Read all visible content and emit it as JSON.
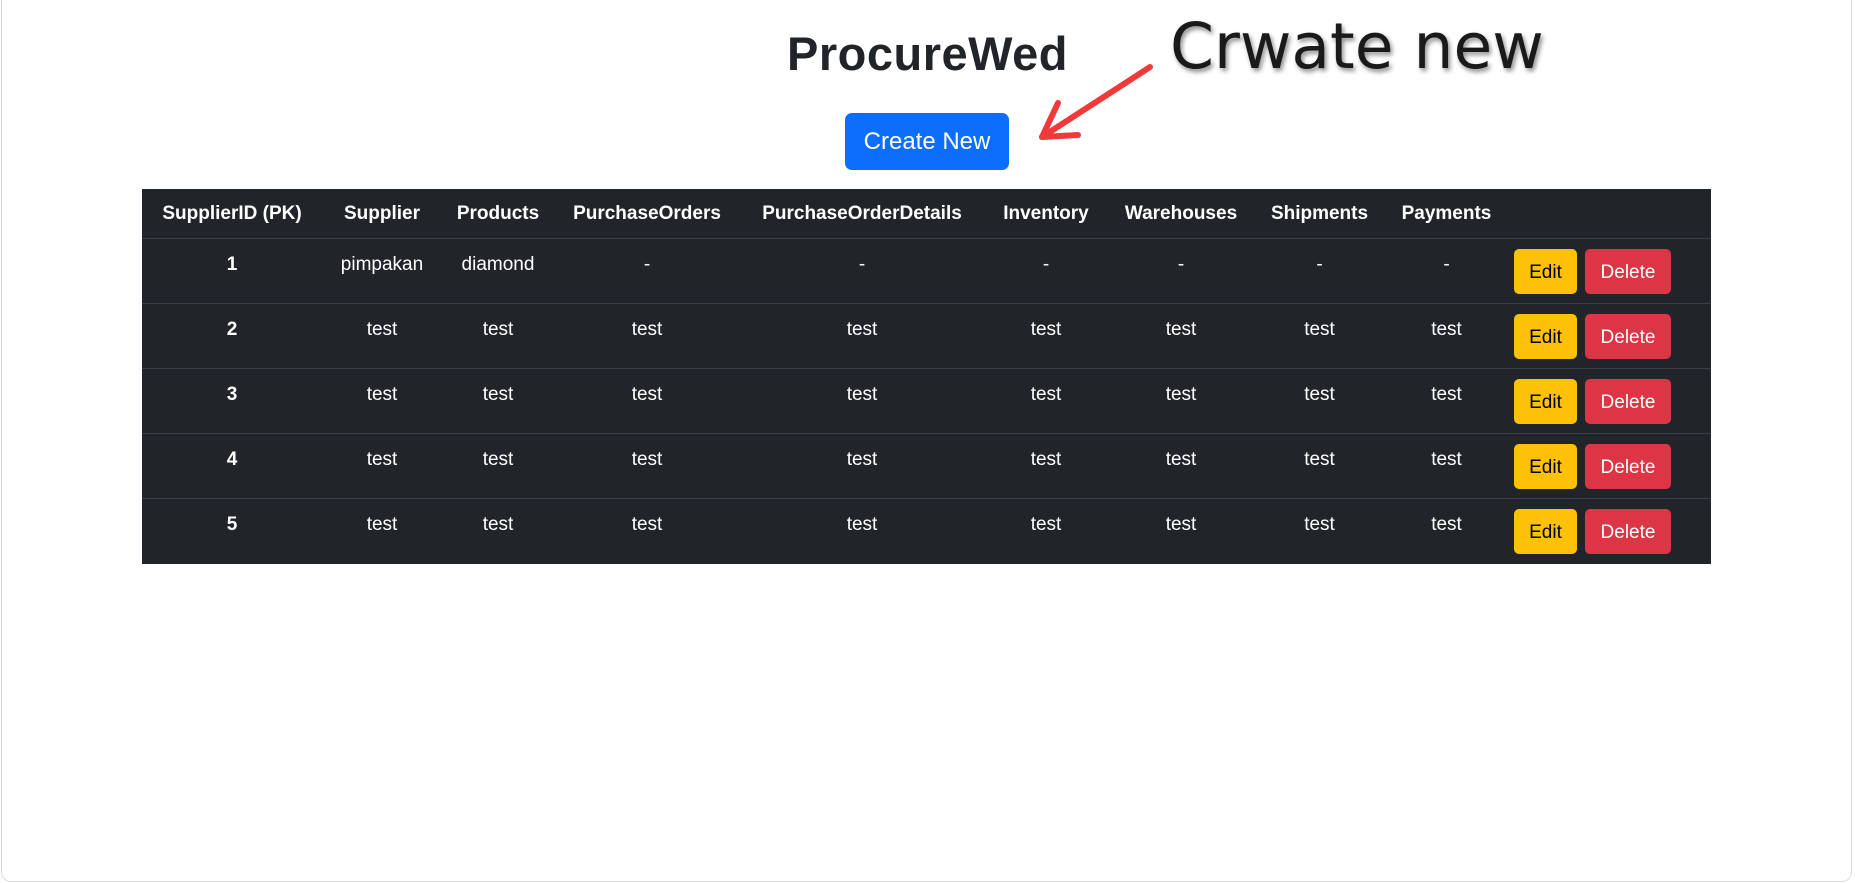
{
  "page": {
    "title": "ProcureWed",
    "create_button_label": "Create New"
  },
  "annotation": {
    "text": "Crwate new",
    "arrow_color": "#f0393a"
  },
  "colors": {
    "primary": "#0d6efd",
    "warning": "#ffc107",
    "danger": "#dc3545",
    "table_bg": "#212529"
  },
  "table": {
    "columns": [
      "SupplierID (PK)",
      "Supplier",
      "Products",
      "PurchaseOrders",
      "PurchaseOrderDetails",
      "Inventory",
      "Warehouses",
      "Shipments",
      "Payments",
      ""
    ],
    "rows": [
      {
        "id": "1",
        "supplier": "pimpakan",
        "products": "diamond",
        "purchase_orders": "-",
        "purchase_order_details": "-",
        "inventory": "-",
        "warehouses": "-",
        "shipments": "-",
        "payments": "-",
        "edit_label": "Edit",
        "delete_label": "Delete"
      },
      {
        "id": "2",
        "supplier": "test",
        "products": "test",
        "purchase_orders": "test",
        "purchase_order_details": "test",
        "inventory": "test",
        "warehouses": "test",
        "shipments": "test",
        "payments": "test",
        "edit_label": "Edit",
        "delete_label": "Delete"
      },
      {
        "id": "3",
        "supplier": "test",
        "products": "test",
        "purchase_orders": "test",
        "purchase_order_details": "test",
        "inventory": "test",
        "warehouses": "test",
        "shipments": "test",
        "payments": "test",
        "edit_label": "Edit",
        "delete_label": "Delete"
      },
      {
        "id": "4",
        "supplier": "test",
        "products": "test",
        "purchase_orders": "test",
        "purchase_order_details": "test",
        "inventory": "test",
        "warehouses": "test",
        "shipments": "test",
        "payments": "test",
        "edit_label": "Edit",
        "delete_label": "Delete"
      },
      {
        "id": "5",
        "supplier": "test",
        "products": "test",
        "purchase_orders": "test",
        "purchase_order_details": "test",
        "inventory": "test",
        "warehouses": "test",
        "shipments": "test",
        "payments": "test",
        "edit_label": "Edit",
        "delete_label": "Delete"
      }
    ]
  }
}
